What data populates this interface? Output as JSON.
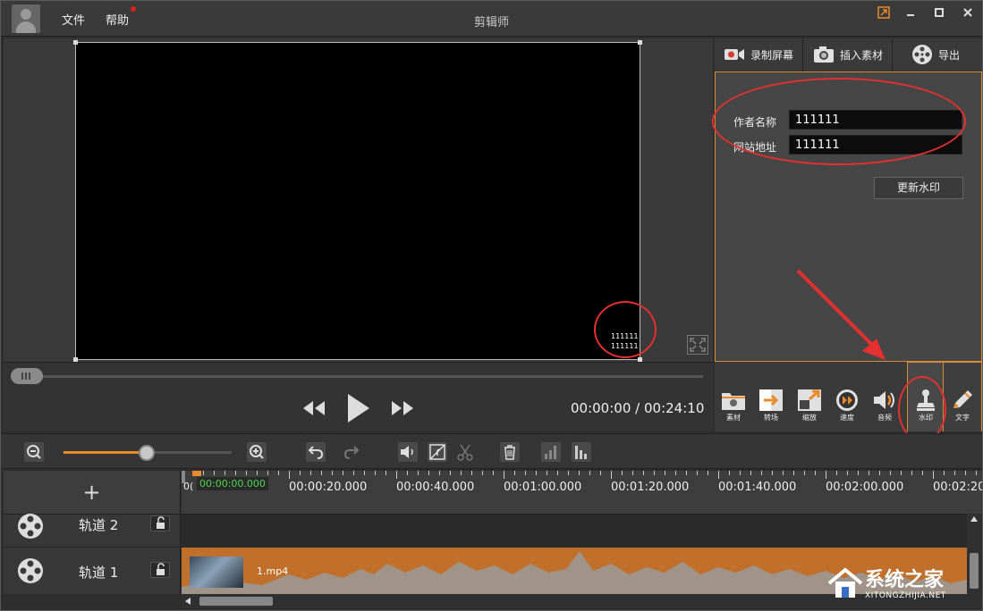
{
  "titlebar": {
    "menus": [
      "文件",
      "帮助"
    ],
    "title": "剪辑师"
  },
  "preview": {
    "watermark_lines": [
      "111111",
      "111111"
    ]
  },
  "playback": {
    "current_time": "00:00:00",
    "separator": "/",
    "total_time": "00:24:10",
    "seek_progress": 0
  },
  "right_tabs": [
    {
      "label": "录制屏幕",
      "icon": "camera-icon"
    },
    {
      "label": "插入素材",
      "icon": "photo-camera-icon"
    },
    {
      "label": "导出",
      "icon": "film-reel-icon"
    }
  ],
  "watermark_panel": {
    "author_label": "作者名称",
    "author_value": "111111",
    "site_label": "网站地址",
    "site_value": "111111",
    "update_button": "更新水印"
  },
  "tools": [
    {
      "label": "素材",
      "icon": "folder-icon"
    },
    {
      "label": "转场",
      "icon": "transition-icon"
    },
    {
      "label": "缩放",
      "icon": "zoom-icon"
    },
    {
      "label": "速度",
      "icon": "speed-icon"
    },
    {
      "label": "音频",
      "icon": "speaker-icon"
    },
    {
      "label": "水印",
      "icon": "stamp-icon"
    },
    {
      "label": "文字",
      "icon": "pencil-icon"
    }
  ],
  "timeline": {
    "zoom_level": 0.5,
    "cursor_time": "00:00:00.000",
    "cursor_prefix": "0(",
    "ticks": [
      "00:00:20.000",
      "00:00:40.000",
      "00:01:00.000",
      "00:01:20.000",
      "00:01:40.000",
      "00:02:00.000",
      "00:02:20"
    ],
    "tracks": [
      {
        "name": "轨道 2"
      },
      {
        "name": "轨道 1"
      }
    ],
    "clip_name": "1.mp4"
  },
  "site_watermark": {
    "brand": "系统之家",
    "url": "XITONGZHIJIA.NET"
  },
  "colors": {
    "accent": "#e98a2c",
    "annotation": "#e53030",
    "clip": "#c0702a",
    "timecode": "#47d84a"
  }
}
